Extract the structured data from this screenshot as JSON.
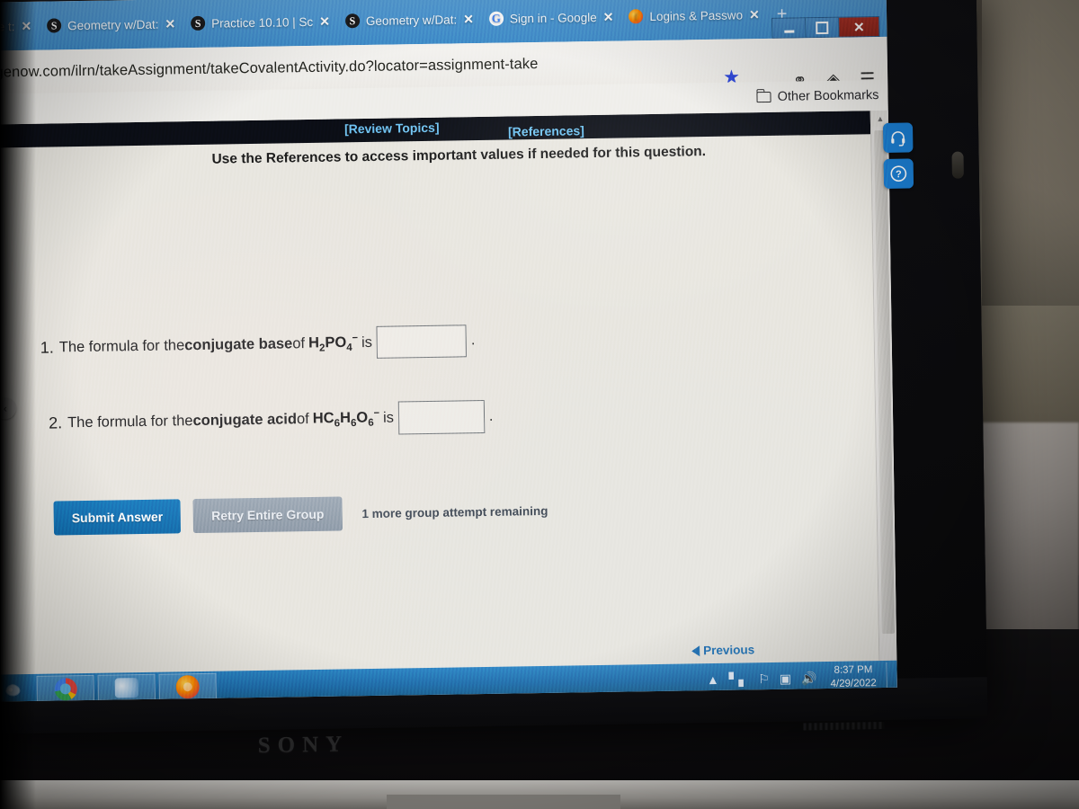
{
  "browser": {
    "tabs": [
      {
        "favicon": "schoology-icon",
        "label": "line t:",
        "close": "✕"
      },
      {
        "favicon": "schoology-icon",
        "label": "Geometry w/Dat:",
        "close": "✕"
      },
      {
        "favicon": "schoology-icon",
        "label": "Practice 10.10 | Sc",
        "close": "✕"
      },
      {
        "favicon": "schoology-icon",
        "label": "Geometry w/Dat:",
        "close": "✕"
      },
      {
        "favicon": "google-icon",
        "label": "Sign in - Google",
        "close": "✕"
      },
      {
        "favicon": "firefox-icon",
        "label": "Logins & Passwo",
        "close": "✕"
      }
    ],
    "new_tab_label": "+",
    "url": "gagenow.com/ilrn/takeAssignment/takeCovalentActivity.do?locator=assignment-take",
    "bookmark_star": "★",
    "window_controls": {
      "minimize": "",
      "maximize": "",
      "close": "✕"
    },
    "bookmarks": {
      "other_bookmarks_label": "Other Bookmarks"
    },
    "toolbar_icons": [
      "shield-icon",
      "extension-icon",
      "menu-icon"
    ]
  },
  "page": {
    "top_links": {
      "review_topics": "[Review Topics]",
      "references": "[References]"
    },
    "references_note": "Use the References to access important values if needed for this question.",
    "questions": [
      {
        "number": "1.",
        "prefix": "The formula for the ",
        "emphasis": "conjugate base",
        "mid": " of ",
        "formula_main": "H",
        "formula_html": "H<sub>2</sub>PO<sub>4</sub><sup>−</sup>",
        "suffix": " is",
        "answer_value": "",
        "trailing": "."
      },
      {
        "number": "2.",
        "prefix": "The formula for the ",
        "emphasis": "conjugate acid",
        "mid": " of ",
        "formula_html": "HC<sub>6</sub>H<sub>6</sub>O<sub>6</sub><sup>−</sup>",
        "suffix": " is",
        "answer_value": "",
        "trailing": "."
      }
    ],
    "buttons": {
      "submit": "Submit Answer",
      "retry": "Retry Entire Group"
    },
    "attempt_note": "1 more group attempt remaining",
    "previous_link": "Previous",
    "side_peek": "‹",
    "help_buttons": [
      {
        "name": "support-headset-icon"
      },
      {
        "name": "help-question-icon"
      }
    ]
  },
  "taskbar": {
    "start_label": "",
    "items": [
      {
        "name": "taskbar-chrome",
        "icon": "chrome-icon"
      },
      {
        "name": "taskbar-app",
        "icon": "app-icon"
      },
      {
        "name": "taskbar-firefox",
        "icon": "firefox-icon"
      }
    ],
    "tray_icons": [
      "show-hidden-icon",
      "network-icon",
      "flag-icon",
      "action-center-icon",
      "volume-icon"
    ],
    "time": "8:37 PM",
    "date": "4/29/2022"
  },
  "hardware": {
    "brand": "SONY"
  },
  "colors": {
    "tab_blue": "#4f99d4",
    "primary_button": "#1378bd",
    "secondary_button": "#8c99a7",
    "link_blue": "#6fc3f2",
    "help_blue": "#1b7fd4",
    "taskbar_blue": "#1f6fae",
    "page_bg": "#e8e6e0",
    "topbar_bg": "#0b0e16"
  }
}
